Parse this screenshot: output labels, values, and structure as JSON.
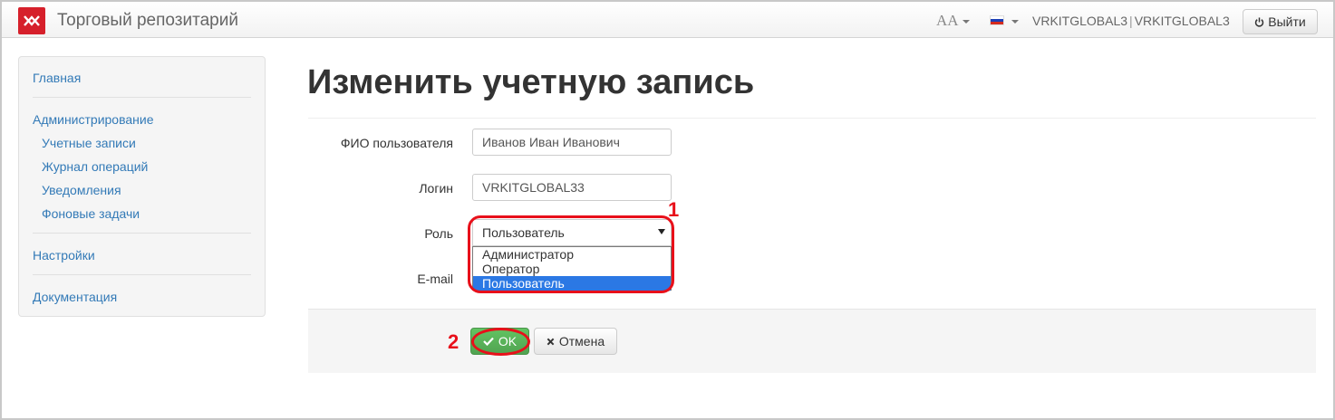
{
  "header": {
    "brand": "Торговый репозитарий",
    "font_toggle": "AA",
    "user_primary": "VRKITGLOBAL3",
    "user_separator": "|",
    "user_secondary": "VRKITGLOBAL3",
    "logout_label": "Выйти",
    "logo_icon": "moex-logo-icon",
    "flag_icon": "russia-flag-icon"
  },
  "sidebar": {
    "items": [
      {
        "label": "Главная"
      },
      {
        "label": "Администрирование"
      },
      {
        "label": "Учетные записи"
      },
      {
        "label": "Журнал операций"
      },
      {
        "label": "Уведомления"
      },
      {
        "label": "Фоновые задачи"
      },
      {
        "label": "Настройки"
      },
      {
        "label": "Документация"
      }
    ]
  },
  "page": {
    "title": "Изменить учетную запись"
  },
  "form": {
    "fullname_label": "ФИО пользователя",
    "fullname_value": "Иванов Иван Иванович",
    "login_label": "Логин",
    "login_value": "VRKITGLOBAL33",
    "role_label": "Роль",
    "role_value": "Пользователь",
    "role_options": [
      "Администратор",
      "Оператор",
      "Пользователь"
    ],
    "email_label": "E-mail"
  },
  "actions": {
    "ok_label": "OK",
    "cancel_label": "Отмена"
  },
  "annotations": {
    "marker1": "1",
    "marker2": "2"
  },
  "colors": {
    "accent_red": "#e8101a",
    "link_blue": "#337ab7",
    "ok_green": "#5bb75b",
    "selected_blue": "#2b78e4"
  }
}
